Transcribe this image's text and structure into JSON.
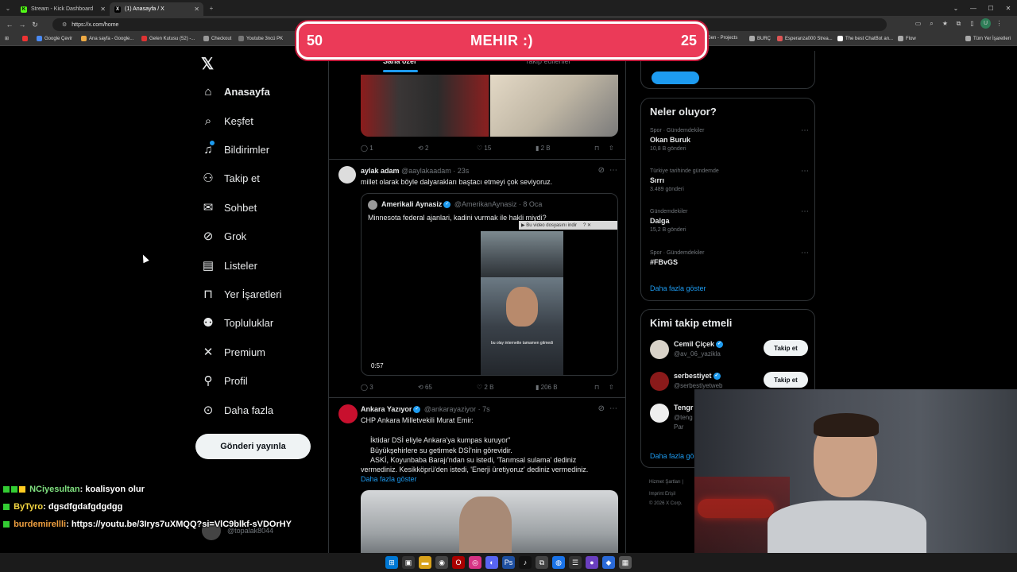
{
  "browser": {
    "tabs": [
      {
        "title": "Stream - Kick Dashboard",
        "icon": "kick-icon",
        "active": false
      },
      {
        "title": "(1) Anasayfa / X",
        "icon": "x-icon",
        "active": true
      }
    ],
    "url": "https://x.com/home",
    "bookmarks": [
      "Google Çevir",
      "Ana sayfa - Google...",
      "Gelen Kutusu (52) -...",
      "Checkout",
      "Youtube 3ncü PK",
      "Gen - Projects",
      "BURÇ",
      "Esperanza000 Strea...",
      "The best ChatBot an...",
      "Flow",
      "Tüm Yer İşaretleri"
    ]
  },
  "overlay": {
    "left": "50",
    "title": "MEHIR :)",
    "right": "25"
  },
  "nav": {
    "items": [
      {
        "label": "Anasayfa",
        "icon": "home-icon",
        "glyph": "⌂"
      },
      {
        "label": "Keşfet",
        "icon": "search-icon",
        "glyph": "⌕"
      },
      {
        "label": "Bildirimler",
        "icon": "bell-icon",
        "glyph": "♫"
      },
      {
        "label": "Takip et",
        "icon": "add-user-icon",
        "glyph": "⚇"
      },
      {
        "label": "Sohbet",
        "icon": "mail-icon",
        "glyph": "✉"
      },
      {
        "label": "Grok",
        "icon": "grok-icon",
        "glyph": "⊘"
      },
      {
        "label": "Listeler",
        "icon": "list-icon",
        "glyph": "▤"
      },
      {
        "label": "Yer İşaretleri",
        "icon": "bookmark-icon",
        "glyph": "⊓"
      },
      {
        "label": "Topluluklar",
        "icon": "communities-icon",
        "glyph": "⚉"
      },
      {
        "label": "Premium",
        "icon": "x-premium-icon",
        "glyph": "✕"
      },
      {
        "label": "Profil",
        "icon": "profile-icon",
        "glyph": "⚲"
      },
      {
        "label": "Daha fazla",
        "icon": "more-icon",
        "glyph": "⊙"
      }
    ],
    "post_button": "Gönderi yayınla",
    "account_handle": "@topalak8044"
  },
  "feed": {
    "tabs": [
      "Sana özel",
      "Takip edilenler"
    ],
    "post0_actions": {
      "replies": "1",
      "reposts": "2",
      "likes": "15",
      "views": "2 B"
    },
    "post1": {
      "name": "aylak adam",
      "handle": "@aaylakaadam",
      "time": "· 23s",
      "text": "millet olarak böyle dalyarakları baştacı etmeyi çok seviyoruz.",
      "quote": {
        "name": "Amerikali Aynasiz",
        "handle": "@AmerikanAynasiz",
        "time": "· 8 Oca",
        "text": "Minnesota federal ajanlari, kadini vurmak ile hakli miydi?",
        "video_download": "Bu video dosyasını indir",
        "duration": "0:57",
        "caption": "bu olay internette tamamen gitmedi"
      },
      "actions": {
        "replies": "3",
        "reposts": "65",
        "likes": "2 B",
        "views": "206 B"
      }
    },
    "post2": {
      "name": "Ankara Yazıyor",
      "handle": "@ankarayaziyor",
      "time": "· 7s",
      "lines": [
        "CHP Ankara Milletvekili Murat Emir:",
        "",
        "İktidar DSİ eliyle Ankara'ya kumpas kuruyor\"",
        "Büyükşehirlere su getirmek DSİ'nin görevidir.",
        "ASKİ, Koyunbaba Barajı'ndan su istedi, 'Tarımsal sulama' dediniz",
        "vermediniz.    Kesikköprü'den istedi, 'Enerji üretiyoruz' dediniz vermediniz."
      ],
      "show_more": "Daha fazla göster"
    }
  },
  "sidebar": {
    "trends_title": "Neler oluyor?",
    "trends": [
      {
        "context": "Spor · Gündemdekiler",
        "name": "Okan Buruk",
        "count": "10,8 B gönderi"
      },
      {
        "context": "Türkiye tarihinde gündemde",
        "name": "Sırrı",
        "count": "3.489 gönderi"
      },
      {
        "context": "Gündemdekiler",
        "name": "Dalga",
        "count": "15,2 B gönderi"
      },
      {
        "context": "Spor · Gündemdekiler",
        "name": "#FBvGS",
        "count": ""
      }
    ],
    "trends_more": "Daha fazla göster",
    "who_title": "Kimi takip etmeli",
    "who": [
      {
        "name": "Cemil Çiçek",
        "handle": "@av_06_yazikla",
        "button": "Takip et"
      },
      {
        "name": "serbestiyet",
        "handle": "@serbestiyetweb",
        "button": "Takip et"
      },
      {
        "name": "Tengr",
        "handle": "@teng",
        "button": ""
      }
    ],
    "who_extra": "Par",
    "who_more": "Daha fazla gö",
    "footer": [
      "Hizmet Şartları |",
      "Imprint  Erişil",
      "© 2026 X Corp."
    ]
  },
  "chat": [
    {
      "user": "NCiyesultan",
      "message": ": koalisyon olur"
    },
    {
      "user": "ByTyro",
      "message": ": dgsdfgdafgdgdgg"
    },
    {
      "user": "burdemirellli",
      "message": ": https://youtu.be/3Irys7uXMQQ?si=VlC9blkf-sVDOrHY"
    }
  ],
  "colors": {
    "accent": "#1d9bf0",
    "overlay": "#eb3a58",
    "chat_user": "#7ec8ff"
  }
}
